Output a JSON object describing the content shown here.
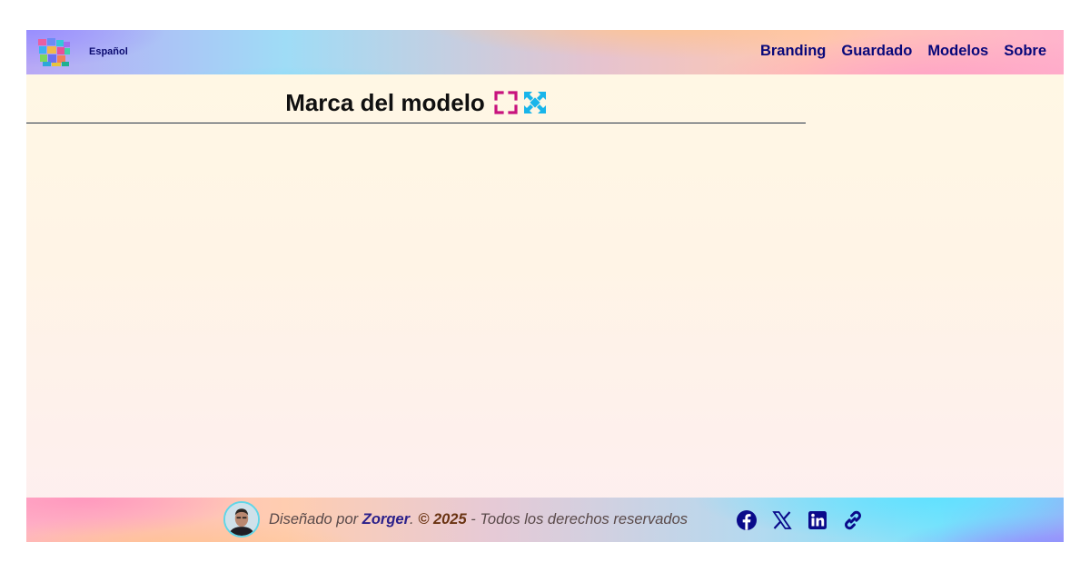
{
  "header": {
    "language": "Español",
    "nav": [
      "Branding",
      "Guardado",
      "Modelos",
      "Sobre"
    ]
  },
  "main": {
    "title": "Marca del modelo",
    "icons": [
      "fullscreen-corners-icon",
      "expand-arrows-icon"
    ]
  },
  "footer": {
    "designed_by": "Diseñado por",
    "author": "Zorger",
    "period": ".",
    "year": "© 2025",
    "rights": "- Todos los derechos reservados",
    "social_icons": [
      "facebook-icon",
      "x-icon",
      "linkedin-icon",
      "link-icon"
    ]
  },
  "colors": {
    "nav_text": "#08087a",
    "title_text": "#101010",
    "fullscreen_icon": "#c8137e",
    "expand_icon": "#19b5ea",
    "social_icon": "#0a0a8a",
    "author": "#2a1f8a",
    "year": "#6a3312"
  }
}
